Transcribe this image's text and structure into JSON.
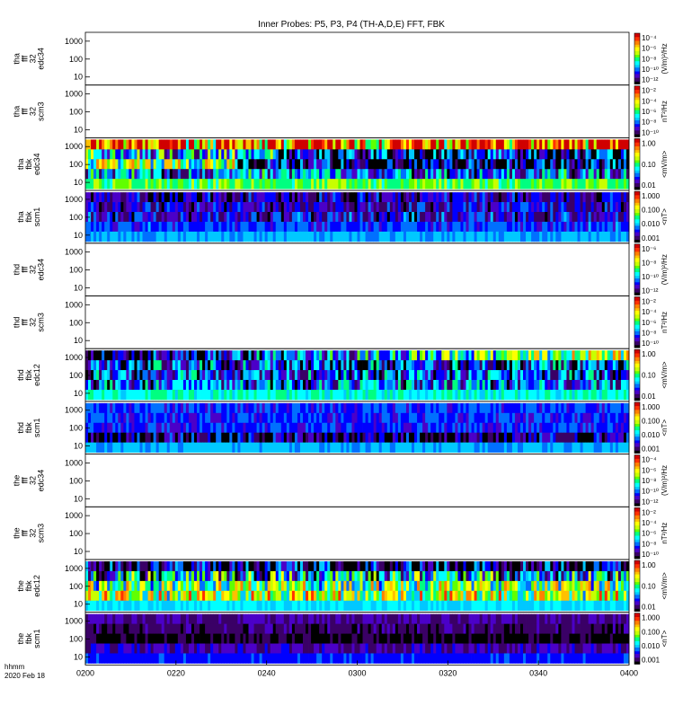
{
  "chart_data": {
    "type": "heatmap",
    "title": "Inner Probes: P5, P3, P4 (TH-A,D,E) FFT, FBK",
    "x": {
      "ticks": [
        "0200",
        "0220",
        "0240",
        "0300",
        "0320",
        "0340",
        "0400"
      ],
      "range_minutes": [
        0,
        120
      ],
      "corner_label": [
        "hhmm",
        "2020 Feb 18"
      ]
    },
    "y_scale": "log",
    "y_ticks": [
      "10",
      "100",
      "1000"
    ],
    "colorscale": [
      "#000000",
      "#3a0066",
      "#4b00c8",
      "#0000ff",
      "#0070ff",
      "#00c8ff",
      "#00ffff",
      "#00ff80",
      "#60ff00",
      "#c8ff00",
      "#ffff00",
      "#ffc000",
      "#ff8000",
      "#ff3000",
      "#d00000"
    ],
    "panels": [
      {
        "id": "tha-fff32-edc34",
        "probe": "tha",
        "label": [
          "tha",
          "fff",
          "32",
          "edc34"
        ],
        "kind": "fff",
        "unit": "(V/m)²/Hz",
        "cb_ticks": [
          "10⁻⁴",
          "10⁻⁶",
          "10⁻⁸",
          "10⁻¹⁰",
          "10⁻¹²"
        ]
      },
      {
        "id": "tha-fff32-scm3",
        "probe": "tha",
        "label": [
          "tha",
          "fff",
          "32",
          "scm3"
        ],
        "kind": "fff",
        "unit": "nT²/Hz",
        "cb_ticks": [
          "10⁻²",
          "10⁻⁴",
          "10⁻⁶",
          "10⁻⁸",
          "10⁻¹⁰"
        ]
      },
      {
        "id": "tha-fbk-edc34",
        "probe": "tha",
        "label": [
          "tha",
          "fbk",
          "edc34"
        ],
        "kind": "fbk",
        "unit": "<mV/m>",
        "cb_ticks": [
          "1.00",
          "0.10",
          "0.01"
        ],
        "bands": [
          {
            "level": 0.9,
            "pattern": "mixed",
            "variability": 0.9
          },
          {
            "level": 0.3,
            "pattern": "segment",
            "switch": 0.35,
            "before": 0.4,
            "after": 0.15,
            "variability": 0.6
          },
          {
            "level": 0.25,
            "pattern": "segment",
            "switch": 0.28,
            "before": 0.55,
            "after": 0.12,
            "variability": 0.6
          },
          {
            "level": 0.3,
            "pattern": "steady",
            "variability": 0.5
          },
          {
            "level": 0.55,
            "pattern": "steady",
            "variability": 0.2
          }
        ]
      },
      {
        "id": "tha-fbk-scm1",
        "probe": "tha",
        "label": [
          "tha",
          "fbk",
          "scm1"
        ],
        "kind": "fbk",
        "unit": "<nT>",
        "cb_ticks": [
          "1.000",
          "0.100",
          "0.010",
          "0.001"
        ],
        "bands": [
          {
            "level": 0.15,
            "pattern": "steady",
            "variability": 0.25
          },
          {
            "level": 0.18,
            "pattern": "steady",
            "variability": 0.25
          },
          {
            "level": 0.2,
            "pattern": "steady",
            "variability": 0.3
          },
          {
            "level": 0.26,
            "pattern": "steady",
            "variability": 0.15
          },
          {
            "level": 0.35,
            "pattern": "steady",
            "variability": 0.1
          }
        ]
      },
      {
        "id": "thd-fff32-edc34",
        "probe": "thd",
        "label": [
          "thd",
          "fff",
          "32",
          "edc34"
        ],
        "kind": "fff",
        "unit": "(V/m)²/Hz",
        "cb_ticks": [
          "10⁻⁶",
          "10⁻⁸",
          "10⁻¹⁰",
          "10⁻¹²"
        ]
      },
      {
        "id": "thd-fff32-scm3",
        "probe": "thd",
        "label": [
          "thd",
          "fff",
          "32",
          "scm3"
        ],
        "kind": "fff",
        "unit": "nT²/Hz",
        "cb_ticks": [
          "10⁻²",
          "10⁻⁴",
          "10⁻⁶",
          "10⁻⁸",
          "10⁻¹⁰"
        ]
      },
      {
        "id": "thd-fbk-edc12",
        "probe": "thd",
        "label": [
          "thd",
          "fbk",
          "edc12"
        ],
        "kind": "fbk",
        "unit": "<mV/m>",
        "cb_ticks": [
          "1.00",
          "0.10",
          "0.01"
        ],
        "bands": [
          {
            "level": 0.05,
            "pattern": "ramp",
            "variability": 0.5
          },
          {
            "level": 0.22,
            "pattern": "mixed",
            "variability": 0.55
          },
          {
            "level": 0.25,
            "pattern": "mixed",
            "variability": 0.5
          },
          {
            "level": 0.28,
            "pattern": "mixed",
            "variability": 0.5
          },
          {
            "level": 0.45,
            "pattern": "steady",
            "variability": 0.15
          }
        ]
      },
      {
        "id": "thd-fbk-scm1",
        "probe": "thd",
        "label": [
          "thd",
          "fbk",
          "scm1"
        ],
        "kind": "fbk",
        "unit": "<nT>",
        "cb_ticks": [
          "1.000",
          "0.100",
          "0.010",
          "0.001"
        ],
        "bands": [
          {
            "level": 0.25,
            "pattern": "steady",
            "variability": 0.15
          },
          {
            "level": 0.25,
            "pattern": "steady",
            "variability": 0.15
          },
          {
            "level": 0.24,
            "pattern": "steady",
            "variability": 0.15
          },
          {
            "level": 0.1,
            "pattern": "mixed",
            "variability": 0.4
          },
          {
            "level": 0.35,
            "pattern": "steady",
            "variability": 0.1
          }
        ]
      },
      {
        "id": "the-fff32-edc34",
        "probe": "the",
        "label": [
          "the",
          "fff",
          "32",
          "edc34"
        ],
        "kind": "fff",
        "unit": "(V/m)²/Hz",
        "cb_ticks": [
          "10⁻⁴",
          "10⁻⁶",
          "10⁻⁸",
          "10⁻¹⁰",
          "10⁻¹²"
        ]
      },
      {
        "id": "the-fff32-scm3",
        "probe": "the",
        "label": [
          "the",
          "fff",
          "32",
          "scm3"
        ],
        "kind": "fff",
        "unit": "nT²/Hz",
        "cb_ticks": [
          "10⁻²",
          "10⁻⁴",
          "10⁻⁶",
          "10⁻⁸",
          "10⁻¹⁰"
        ]
      },
      {
        "id": "the-fbk-edc12",
        "probe": "the",
        "label": [
          "the",
          "fbk",
          "edc12"
        ],
        "kind": "fbk",
        "unit": "<mV/m>",
        "cb_ticks": [
          "1.00",
          "0.10",
          "0.01"
        ],
        "bands": [
          {
            "level": 0.1,
            "pattern": "mixed",
            "variability": 0.6
          },
          {
            "level": 0.35,
            "pattern": "mixed",
            "variability": 0.7
          },
          {
            "level": 0.55,
            "pattern": "mixed",
            "variability": 0.6
          },
          {
            "level": 0.62,
            "pattern": "mixed",
            "variability": 0.6
          },
          {
            "level": 0.4,
            "pattern": "steady",
            "variability": 0.1
          }
        ]
      },
      {
        "id": "the-fbk-scm1",
        "probe": "the",
        "label": [
          "the",
          "fbk",
          "scm1"
        ],
        "kind": "fbk",
        "unit": "<nT>",
        "cb_ticks": [
          "1.000",
          "0.100",
          "0.010",
          "0.001"
        ],
        "bands": [
          {
            "level": 0.13,
            "pattern": "steady",
            "variability": 0.05
          },
          {
            "level": 0.1,
            "pattern": "steady",
            "variability": 0.1
          },
          {
            "level": 0.05,
            "pattern": "steady",
            "variability": 0.1
          },
          {
            "level": 0.15,
            "pattern": "steady",
            "variability": 0.15
          },
          {
            "level": 0.25,
            "pattern": "steady",
            "variability": 0.05
          }
        ]
      }
    ]
  }
}
